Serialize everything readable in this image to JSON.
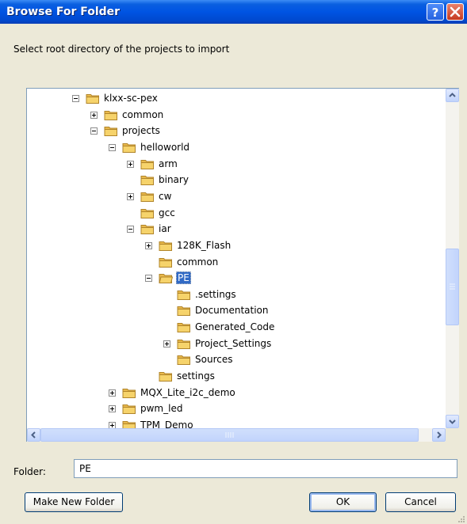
{
  "window": {
    "title": "Browse For Folder",
    "help_label": "?",
    "close_label": "×"
  },
  "instruction": "Select root directory of the projects to import",
  "tree": {
    "nodes": [
      {
        "label": "klxx-sc-pex",
        "depth": 0,
        "expander": "minus",
        "selected": false
      },
      {
        "label": "common",
        "depth": 1,
        "expander": "plus",
        "selected": false
      },
      {
        "label": "projects",
        "depth": 1,
        "expander": "minus",
        "selected": false
      },
      {
        "label": "helloworld",
        "depth": 2,
        "expander": "minus",
        "selected": false
      },
      {
        "label": "arm",
        "depth": 3,
        "expander": "plus",
        "selected": false
      },
      {
        "label": "binary",
        "depth": 3,
        "expander": "none",
        "selected": false
      },
      {
        "label": "cw",
        "depth": 3,
        "expander": "plus",
        "selected": false
      },
      {
        "label": "gcc",
        "depth": 3,
        "expander": "none",
        "selected": false
      },
      {
        "label": "iar",
        "depth": 3,
        "expander": "minus",
        "selected": false
      },
      {
        "label": "128K_Flash",
        "depth": 4,
        "expander": "plus",
        "selected": false
      },
      {
        "label": "common",
        "depth": 4,
        "expander": "none",
        "selected": false
      },
      {
        "label": "PE",
        "depth": 4,
        "expander": "minus",
        "selected": true
      },
      {
        "label": ".settings",
        "depth": 5,
        "expander": "none",
        "selected": false
      },
      {
        "label": "Documentation",
        "depth": 5,
        "expander": "none",
        "selected": false
      },
      {
        "label": "Generated_Code",
        "depth": 5,
        "expander": "none",
        "selected": false
      },
      {
        "label": "Project_Settings",
        "depth": 5,
        "expander": "plus",
        "selected": false
      },
      {
        "label": "Sources",
        "depth": 5,
        "expander": "none",
        "selected": false
      },
      {
        "label": "settings",
        "depth": 4,
        "expander": "none",
        "selected": false
      },
      {
        "label": "MQX_Lite_i2c_demo",
        "depth": 2,
        "expander": "plus",
        "selected": false
      },
      {
        "label": "pwm_led",
        "depth": 2,
        "expander": "plus",
        "selected": false
      },
      {
        "label": "TPM_Demo",
        "depth": 2,
        "expander": "plus",
        "selected": false
      }
    ]
  },
  "scroll": {
    "vertical_position": 0.62,
    "horizontal_position": 0.0
  },
  "folder": {
    "label": "Folder:",
    "value": "PE"
  },
  "buttons": {
    "make_new_folder": "Make New Folder",
    "ok": "OK",
    "cancel": "Cancel"
  },
  "colors": {
    "titlebar": "#0054e3",
    "selection": "#316ac5",
    "dialog_bg": "#ece9d8",
    "folder_yellow": "#f6d36b"
  }
}
